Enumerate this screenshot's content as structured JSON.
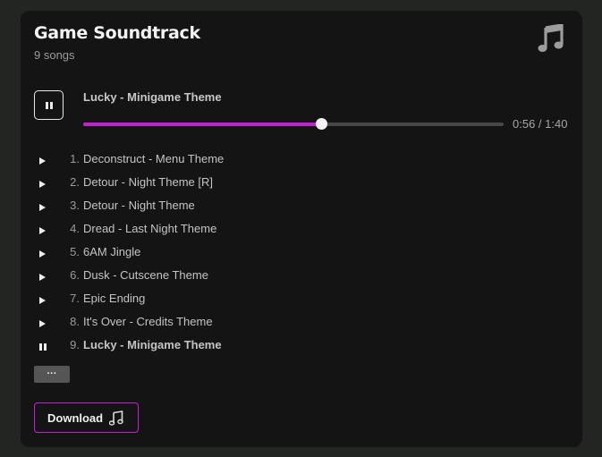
{
  "album": {
    "title": "Game Soundtrack",
    "song_count": "9 songs",
    "icon": "music-note-icon"
  },
  "player": {
    "state": "playing",
    "now_playing": "Lucky - Minigame Theme",
    "time": "0:56 / 1:40",
    "progress": 0.567,
    "accent_color": "#c61fd6"
  },
  "tracks": [
    {
      "num": "1.",
      "title": "Deconstruct - Menu Theme",
      "state": "play"
    },
    {
      "num": "2.",
      "title": "Detour - Night Theme [R]",
      "state": "play"
    },
    {
      "num": "3.",
      "title": "Detour - Night Theme",
      "state": "play"
    },
    {
      "num": "4.",
      "title": "Dread - Last Night Theme",
      "state": "play"
    },
    {
      "num": "5.",
      "title": "6AM Jingle",
      "state": "play"
    },
    {
      "num": "6.",
      "title": "Dusk - Cutscene Theme",
      "state": "play"
    },
    {
      "num": "7.",
      "title": "Epic Ending",
      "state": "play"
    },
    {
      "num": "8.",
      "title": "It's Over - Credits Theme",
      "state": "play"
    },
    {
      "num": "9.",
      "title": "Lucky - Minigame Theme",
      "state": "pause"
    }
  ],
  "more_button": {
    "label": "···"
  },
  "download": {
    "label": "Download",
    "icon": "music-note-icon"
  }
}
